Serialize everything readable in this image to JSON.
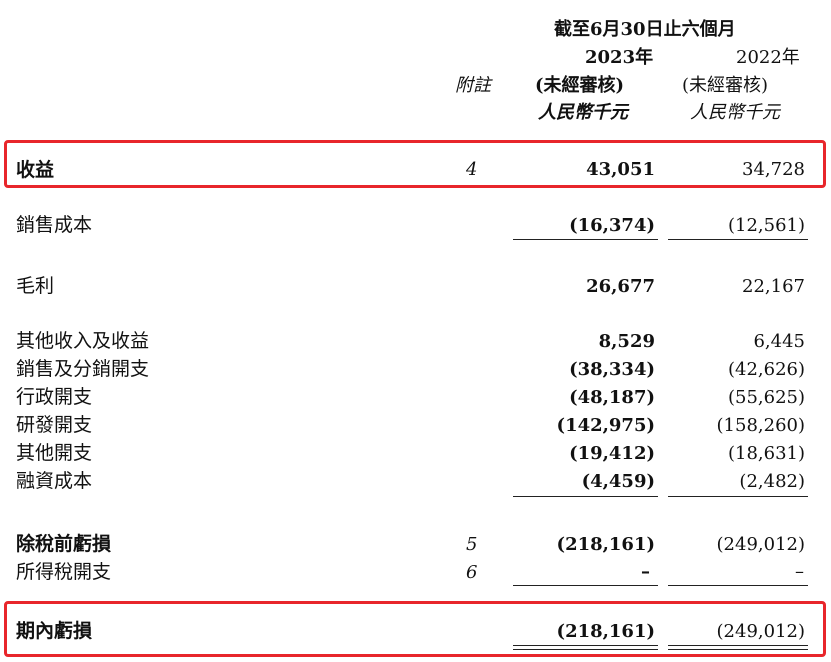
{
  "header": {
    "period": "截至6月30日止六個月",
    "note_label": "附註",
    "col2023": {
      "year": "2023年",
      "audit": "(未經審核)",
      "unit": "人民幣千元"
    },
    "col2022": {
      "year": "2022年",
      "audit": "(未經審核)",
      "unit": "人民幣千元"
    }
  },
  "rows": [
    {
      "label": "收益",
      "note": "4",
      "v2023": "43,051",
      "v2022": "34,728"
    },
    {
      "label": "銷售成本",
      "note": "",
      "v2023": "(16,374)",
      "v2022": "(12,561)"
    },
    {
      "label": "毛利",
      "note": "",
      "v2023": "26,677",
      "v2022": "22,167"
    },
    {
      "label": "其他收入及收益",
      "note": "",
      "v2023": "8,529",
      "v2022": "6,445"
    },
    {
      "label": "銷售及分銷開支",
      "note": "",
      "v2023": "(38,334)",
      "v2022": "(42,626)"
    },
    {
      "label": "行政開支",
      "note": "",
      "v2023": "(48,187)",
      "v2022": "(55,625)"
    },
    {
      "label": "研發開支",
      "note": "",
      "v2023": "(142,975)",
      "v2022": "(158,260)"
    },
    {
      "label": "其他開支",
      "note": "",
      "v2023": "(19,412)",
      "v2022": "(18,631)"
    },
    {
      "label": "融資成本",
      "note": "",
      "v2023": "(4,459)",
      "v2022": "(2,482)"
    },
    {
      "label": "除稅前虧損",
      "note": "5",
      "v2023": "(218,161)",
      "v2022": "(249,012)"
    },
    {
      "label": "所得稅開支",
      "note": "6",
      "v2023": "–",
      "v2022": "–"
    },
    {
      "label": "期內虧損",
      "note": "",
      "v2023": "(218,161)",
      "v2022": "(249,012)"
    }
  ],
  "highlight_color": "#e8262b"
}
